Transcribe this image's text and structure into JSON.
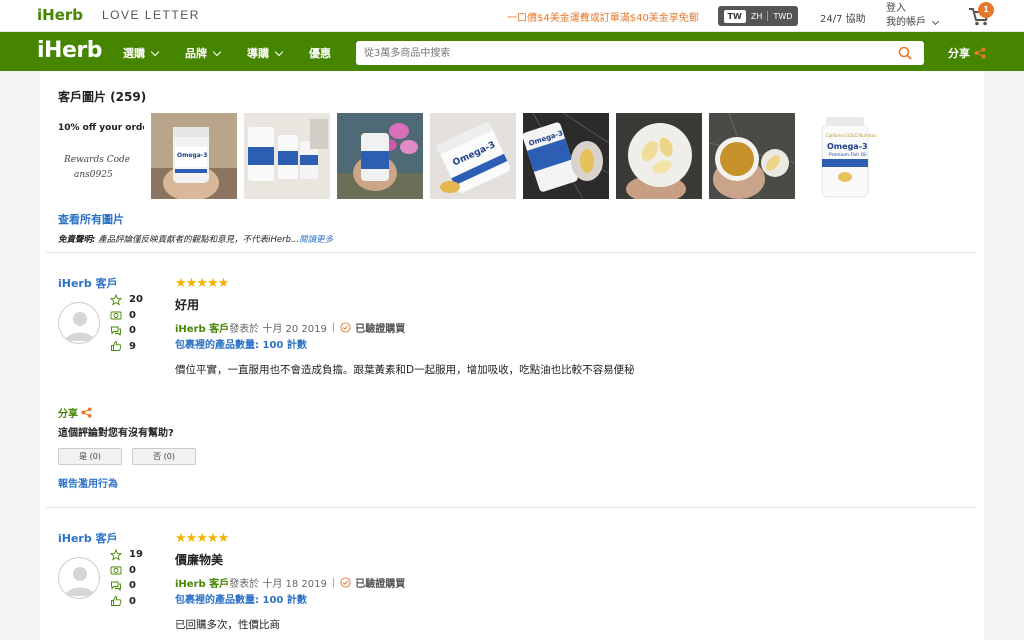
{
  "topbar": {
    "logo": "iHerb",
    "love_letter": "LOVE LETTER",
    "promo": "一口價$4美金運費或訂單滿$40美金享免郵",
    "lang": [
      "TW",
      "ZH",
      "TWD"
    ],
    "help": "24/7 協助",
    "login": "登入",
    "account": "我的帳戶",
    "cart_count": "1"
  },
  "navbar": {
    "logo": "iHerb",
    "items": [
      "選購",
      "品牌",
      "導購",
      "優惠"
    ],
    "search_placeholder": "從3萬多商品中搜索",
    "share": "分享"
  },
  "photos": {
    "title": "客戶圖片 (259)",
    "promo_line1": "10% off your order",
    "promo_line2": "Rewards Code",
    "promo_line3": "ans0925",
    "product_label1": "Omega-3",
    "product_label2": "Premium Fish Oil",
    "product_brand": "California GOLD Nutrition",
    "view_all": "查看所有圖片",
    "disclaimer_label": "免責聲明:",
    "disclaimer_text": " 產品評論僅反映貢獻者的觀點和意見，不代表iHerb...",
    "read_more": "閱讀更多"
  },
  "reviews": [
    {
      "reviewer": "iHerb 客戶",
      "stats": [
        "20",
        "0",
        "0",
        "9"
      ],
      "stars": "★★★★★",
      "title": "好用",
      "author": "iHerb 客戶",
      "posted": "發表於 十月 20 2019",
      "verified": "已驗證購買",
      "qty": "包裹裡的產品數量: 100 計數",
      "body": "價位平實，一直服用也不會造成負擔。跟葉黃素和D一起服用，增加吸收，吃點油也比較不容易便秘",
      "share": "分享",
      "helpful": "這個評論對您有沒有幫助?",
      "yes": "是 (0)",
      "no": "否 (0)",
      "report": "報告濫用行為"
    },
    {
      "reviewer": "iHerb 客戶",
      "stats": [
        "19",
        "0",
        "0",
        "0"
      ],
      "stars": "★★★★★",
      "title": "價廉物美",
      "author": "iHerb 客戶",
      "posted": "發表於 十月 18 2019",
      "verified": "已驗證購買",
      "qty": "包裹裡的產品數量: 100 計數",
      "body": "已回購多次，性價比商"
    }
  ],
  "colors": {
    "brand_green": "#458500",
    "link_blue": "#2d73c7",
    "accent_orange": "#e8792a",
    "star": "#f5b301"
  }
}
